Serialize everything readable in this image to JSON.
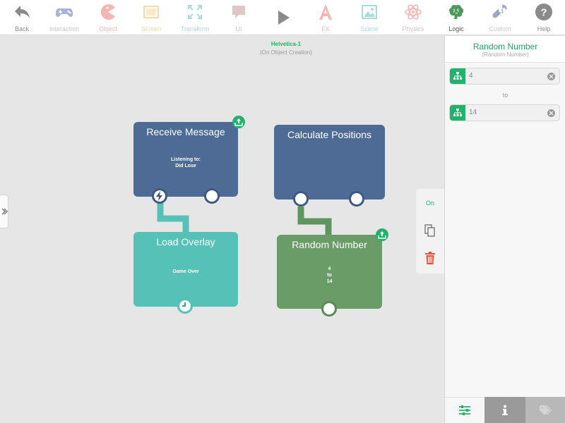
{
  "toolbar": {
    "items": [
      {
        "label": "Back",
        "icon": "back-arrow-icon"
      },
      {
        "label": "Interaction",
        "icon": "gamepad-icon"
      },
      {
        "label": "Object",
        "icon": "pacman-icon"
      },
      {
        "label": "Screen",
        "icon": "screen-icon"
      },
      {
        "label": "Transform",
        "icon": "transform-icon"
      },
      {
        "label": "UI",
        "icon": "speech-bubble-icon"
      },
      {
        "label": "",
        "icon": "play-icon"
      },
      {
        "label": "FX",
        "icon": "fx-icon"
      },
      {
        "label": "Scene",
        "icon": "scene-icon"
      },
      {
        "label": "Physics",
        "icon": "atom-icon"
      },
      {
        "label": "Logic",
        "icon": "brain-icon"
      },
      {
        "label": "Custom",
        "icon": "wrench-icon"
      },
      {
        "label": "Help",
        "icon": "help-icon"
      }
    ]
  },
  "canvas": {
    "title": "Helvetica-1",
    "subtitle": "(On Object Creation)"
  },
  "blocks": {
    "receive_message": {
      "title": "Receive Message",
      "body_line1": "Listening to:",
      "body_line2": "Did Lose"
    },
    "calculate_positions": {
      "title": "Calculate Positions"
    },
    "load_overlay": {
      "title": "Load Overlay",
      "body": "Game Over"
    },
    "random_number": {
      "title": "Random Number",
      "line1": "4",
      "line2": "to",
      "line3": "14"
    }
  },
  "action_menu": {
    "on_label": "On"
  },
  "panel": {
    "title": "Random Number",
    "subtitle": "(Random Number)",
    "from_value": "4",
    "to_label": "to",
    "to_value": "14"
  },
  "colors": {
    "accent": "#21b36b",
    "block_blue": "#4d6b94",
    "block_teal": "#55c1b7",
    "block_green": "#699c66",
    "delete_red": "#e8503a"
  }
}
